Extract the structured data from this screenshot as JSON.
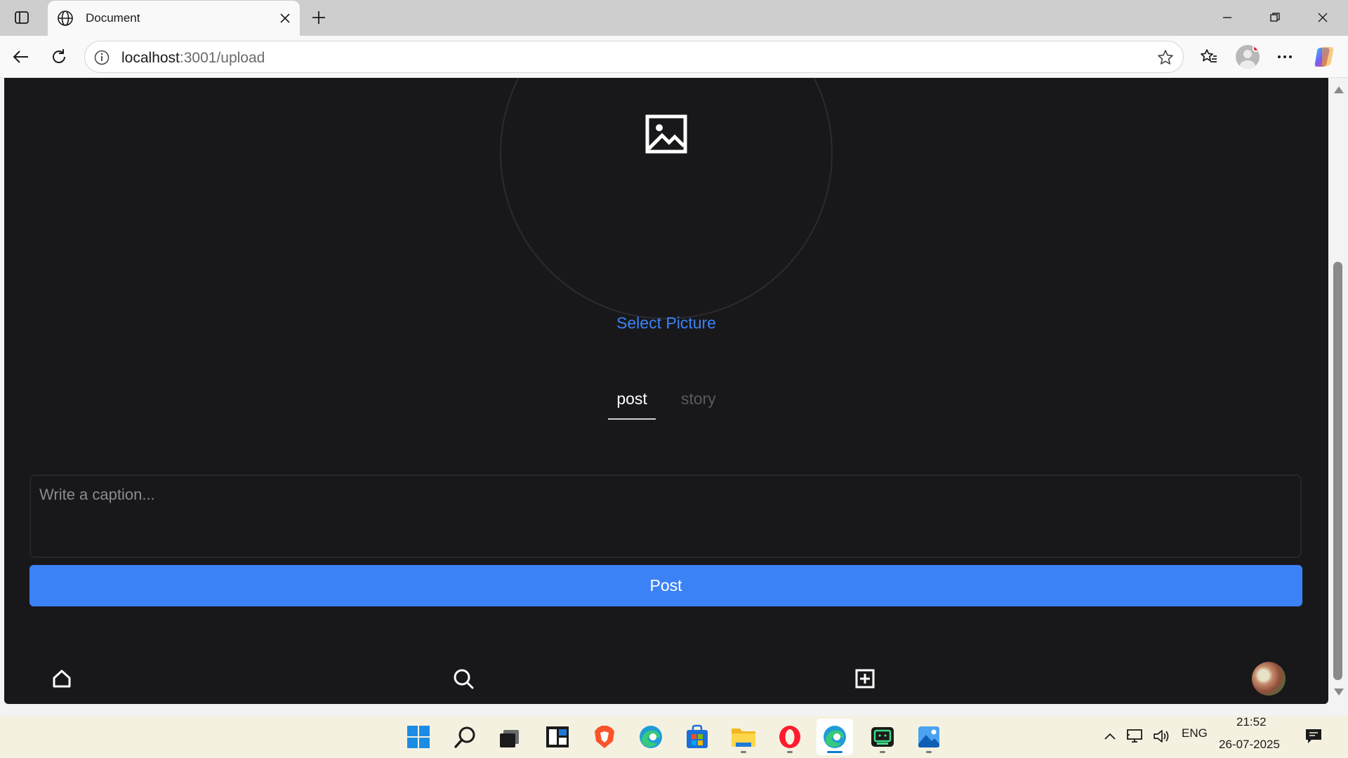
{
  "browser": {
    "tab_title": "Document",
    "url_host": "localhost",
    "url_rest": ":3001/upload"
  },
  "page": {
    "select_picture_label": "Select Picture",
    "tabs": [
      {
        "label": "post",
        "active": true
      },
      {
        "label": "story",
        "active": false
      }
    ],
    "caption_placeholder": "Write a caption...",
    "post_button_label": "Post",
    "accent_color": "#3b82f6",
    "background_color": "#18181b"
  },
  "bottom_nav": {
    "items": [
      "home-icon",
      "search-icon",
      "add-post-icon",
      "profile-avatar"
    ]
  },
  "taskbar": {
    "apps": [
      "start-icon",
      "search-icon",
      "task-view-icon",
      "widgets-icon",
      "brave-icon",
      "edge-icon",
      "store-icon",
      "file-explorer-icon",
      "opera-icon",
      "edge-active-icon",
      "terminal-icon",
      "photos-icon"
    ],
    "language": "ENG",
    "time": "21:52",
    "date": "26-07-2025"
  }
}
